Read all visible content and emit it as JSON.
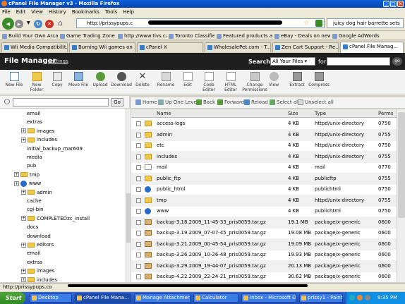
{
  "window": {
    "title": "cPanel File Manager v3 - Mozilla Firefox"
  },
  "menu": [
    "File",
    "Edit",
    "View",
    "History",
    "Bookmarks",
    "Tools",
    "Help"
  ],
  "nav": {
    "url": "http://prissypups.c",
    "search_value": "juicy dog hair barrette sets"
  },
  "bookmarks": [
    "Build Your Own Arcad...",
    "Game Trading Zone - ...",
    "http://www.tivs.ca/",
    "Toronto Classifieds",
    "Featured products an...",
    "eBay - Deals on new ...",
    "Google AdWords"
  ],
  "tabs": [
    "Wii Media Compatibilit...",
    "Burning Wii games on ...",
    "cPanel X",
    "WholesalePet.com - T...",
    "Zen Cart Support - Re...",
    "cPanel File Manag..."
  ],
  "fm": {
    "title": "File Manager",
    "settings": "Settings",
    "search_label": "Search",
    "search_scope": "All Your Files",
    "for_label": "for",
    "go": "go"
  },
  "toolbar": [
    "New File",
    "New Folder",
    "Copy",
    "Move File",
    "Upload",
    "Download",
    "Delete",
    "Rename",
    "Edit",
    "Code Editor",
    "HTML Editor",
    "Change Permissions",
    "View",
    "Extract",
    "Compress"
  ],
  "tree": {
    "go": "Go",
    "items": [
      {
        "label": "email",
        "kind": "text",
        "indent": 38
      },
      {
        "label": "extras",
        "kind": "text",
        "indent": 38
      },
      {
        "label": "images",
        "kind": "folder",
        "indent": 30,
        "plus": true
      },
      {
        "label": "includes",
        "kind": "folder",
        "indent": 30,
        "plus": true
      },
      {
        "label": "initial_backup_mar609",
        "kind": "text",
        "indent": 38
      },
      {
        "label": "media",
        "kind": "text",
        "indent": 38
      },
      {
        "label": "pub",
        "kind": "text",
        "indent": 38
      },
      {
        "label": "tmp",
        "kind": "folder",
        "indent": 20,
        "plus": true
      },
      {
        "label": "www",
        "kind": "globe",
        "indent": 20,
        "plus": true
      },
      {
        "label": "admin",
        "kind": "folder",
        "indent": 30,
        "plus": true
      },
      {
        "label": "cache",
        "kind": "text",
        "indent": 38
      },
      {
        "label": "cgi-bin",
        "kind": "text",
        "indent": 38
      },
      {
        "label": "COMPLETEDzc_install",
        "kind": "folder",
        "indent": 30,
        "plus": true
      },
      {
        "label": "docs",
        "kind": "text",
        "indent": 38
      },
      {
        "label": "download",
        "kind": "text",
        "indent": 38
      },
      {
        "label": "editors",
        "kind": "folder",
        "indent": 30,
        "plus": true
      },
      {
        "label": "email",
        "kind": "text",
        "indent": 38
      },
      {
        "label": "extras",
        "kind": "text",
        "indent": 38
      },
      {
        "label": "images",
        "kind": "folder",
        "indent": 30,
        "plus": true
      },
      {
        "label": "includes",
        "kind": "folder",
        "indent": 30,
        "plus": true
      }
    ]
  },
  "actions": [
    "Home",
    "Up One Level",
    "Back",
    "Forward",
    "Reload",
    "Select all",
    "Unselect all"
  ],
  "columns": [
    "Name",
    "Size",
    "Type",
    "Perms"
  ],
  "files": [
    {
      "icon": "folder",
      "name": "access-logs",
      "size": "4 KB",
      "type": "httpd/unix-directory",
      "perms": "0750"
    },
    {
      "icon": "folder",
      "name": "admin",
      "size": "4 KB",
      "type": "httpd/unix-directory",
      "perms": "0755"
    },
    {
      "icon": "folder",
      "name": "etc",
      "size": "4 KB",
      "type": "httpd/unix-directory",
      "perms": "0750"
    },
    {
      "icon": "folder",
      "name": "includes",
      "size": "4 KB",
      "type": "httpd/unix-directory",
      "perms": "0755"
    },
    {
      "icon": "mail",
      "name": "mail",
      "size": "4 KB",
      "type": "mail",
      "perms": "0770"
    },
    {
      "icon": "folder",
      "name": "public_ftp",
      "size": "4 KB",
      "type": "publicftp",
      "perms": "0755"
    },
    {
      "icon": "globe",
      "name": "public_html",
      "size": "4 KB",
      "type": "publichtml",
      "perms": "0750"
    },
    {
      "icon": "folder",
      "name": "tmp",
      "size": "4 KB",
      "type": "httpd/unix-directory",
      "perms": "0755"
    },
    {
      "icon": "globe",
      "name": "www",
      "size": "4 KB",
      "type": "publichtml",
      "perms": "0750"
    },
    {
      "icon": "archive",
      "name": "backup-3.18.2009_11-45-33_pris0059.tar.gz",
      "size": "19.1 MB",
      "type": "package/x-generic",
      "perms": "0600"
    },
    {
      "icon": "archive",
      "name": "backup-3.19.2009_07-07-45_pris0059.tar.gz",
      "size": "19.08 MB",
      "type": "package/x-generic",
      "perms": "0600"
    },
    {
      "icon": "archive",
      "name": "backup-3.21.2009_00-45-54_pris0059.tar.gz",
      "size": "19.09 MB",
      "type": "package/x-generic",
      "perms": "0600"
    },
    {
      "icon": "archive",
      "name": "backup-3.26.2009_10-26-48_pris0059.tar.gz",
      "size": "19.93 MB",
      "type": "package/x-generic",
      "perms": "0600"
    },
    {
      "icon": "archive",
      "name": "backup-3.29.2009_19-44-07_pris0059.tar.gz",
      "size": "20.13 MB",
      "type": "package/x-generic",
      "perms": "0600"
    },
    {
      "icon": "archive",
      "name": "backup-4.22.2009_22-24-21_pris0059.tar.gz",
      "size": "30.62 MB",
      "type": "package/x-generic",
      "perms": "0600"
    }
  ],
  "status": "http://prissypups.co",
  "taskbar": {
    "start": "Start",
    "tasks": [
      "Desktop",
      "cPanel File Mana...",
      "Manage Attachmen...",
      "Calculator",
      "Inbox - Microsoft O...",
      "prissy1 - Paint"
    ],
    "clock": "9:35 PM"
  },
  "colors": {
    "titlebar": "#0a5fd8",
    "fm_header": "#1f1f1f",
    "taskbar": "#3168d5",
    "folder": "#f0c84a"
  }
}
